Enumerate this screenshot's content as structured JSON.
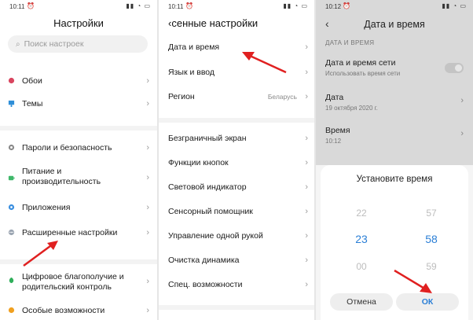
{
  "panel1": {
    "status_time": "10:11",
    "title": "Настройки",
    "search_placeholder": "Поиск настроек",
    "items": [
      {
        "label": "Обои"
      },
      {
        "label": "Темы"
      },
      {
        "label": "Пароли и безопасность"
      },
      {
        "label": "Питание и производительность"
      },
      {
        "label": "Приложения"
      },
      {
        "label": "Расширенные настройки"
      },
      {
        "label": "Цифровое благополучие и родительский контроль"
      },
      {
        "label": "Особые возможности"
      }
    ]
  },
  "panel2": {
    "status_time": "10:11",
    "title": "сенные настройки",
    "items": [
      {
        "label": "Дата и время"
      },
      {
        "label": "Язык и ввод"
      },
      {
        "label": "Регион",
        "value": "Беларусь"
      },
      {
        "label": "Безграничный экран"
      },
      {
        "label": "Функции кнопок"
      },
      {
        "label": "Световой индикатор"
      },
      {
        "label": "Сенсорный помощник"
      },
      {
        "label": "Управление одной рукой"
      },
      {
        "label": "Очистка динамика"
      },
      {
        "label": "Спец. возможности"
      }
    ]
  },
  "panel3": {
    "status_time": "10:12",
    "title": "Дата и время",
    "section": "ДАТА И ВРЕМЯ",
    "network_time_label": "Дата и время сети",
    "network_time_sub": "Использовать время сети",
    "network_time_on": false,
    "date_label": "Дата",
    "date_value": "19 октября 2020 г.",
    "time_label": "Время",
    "time_value": "10:12",
    "dialog_title": "Установите время",
    "hours": [
      "22",
      "23",
      "00"
    ],
    "minutes": [
      "57",
      "58",
      "59"
    ],
    "selected_hour": "23",
    "selected_minute": "58",
    "cancel_label": "Отмена",
    "ok_label": "ОК"
  },
  "colors": {
    "accent": "#2b7fd6",
    "arrow": "#e02020"
  },
  "icons": {
    "wallpaper": "flower-icon",
    "themes": "brush-icon",
    "passwords": "gear-icon",
    "battery": "battery-icon",
    "apps": "apps-icon",
    "advanced": "dots-icon",
    "wellbeing": "leaf-icon",
    "accessibility": "person-icon"
  }
}
